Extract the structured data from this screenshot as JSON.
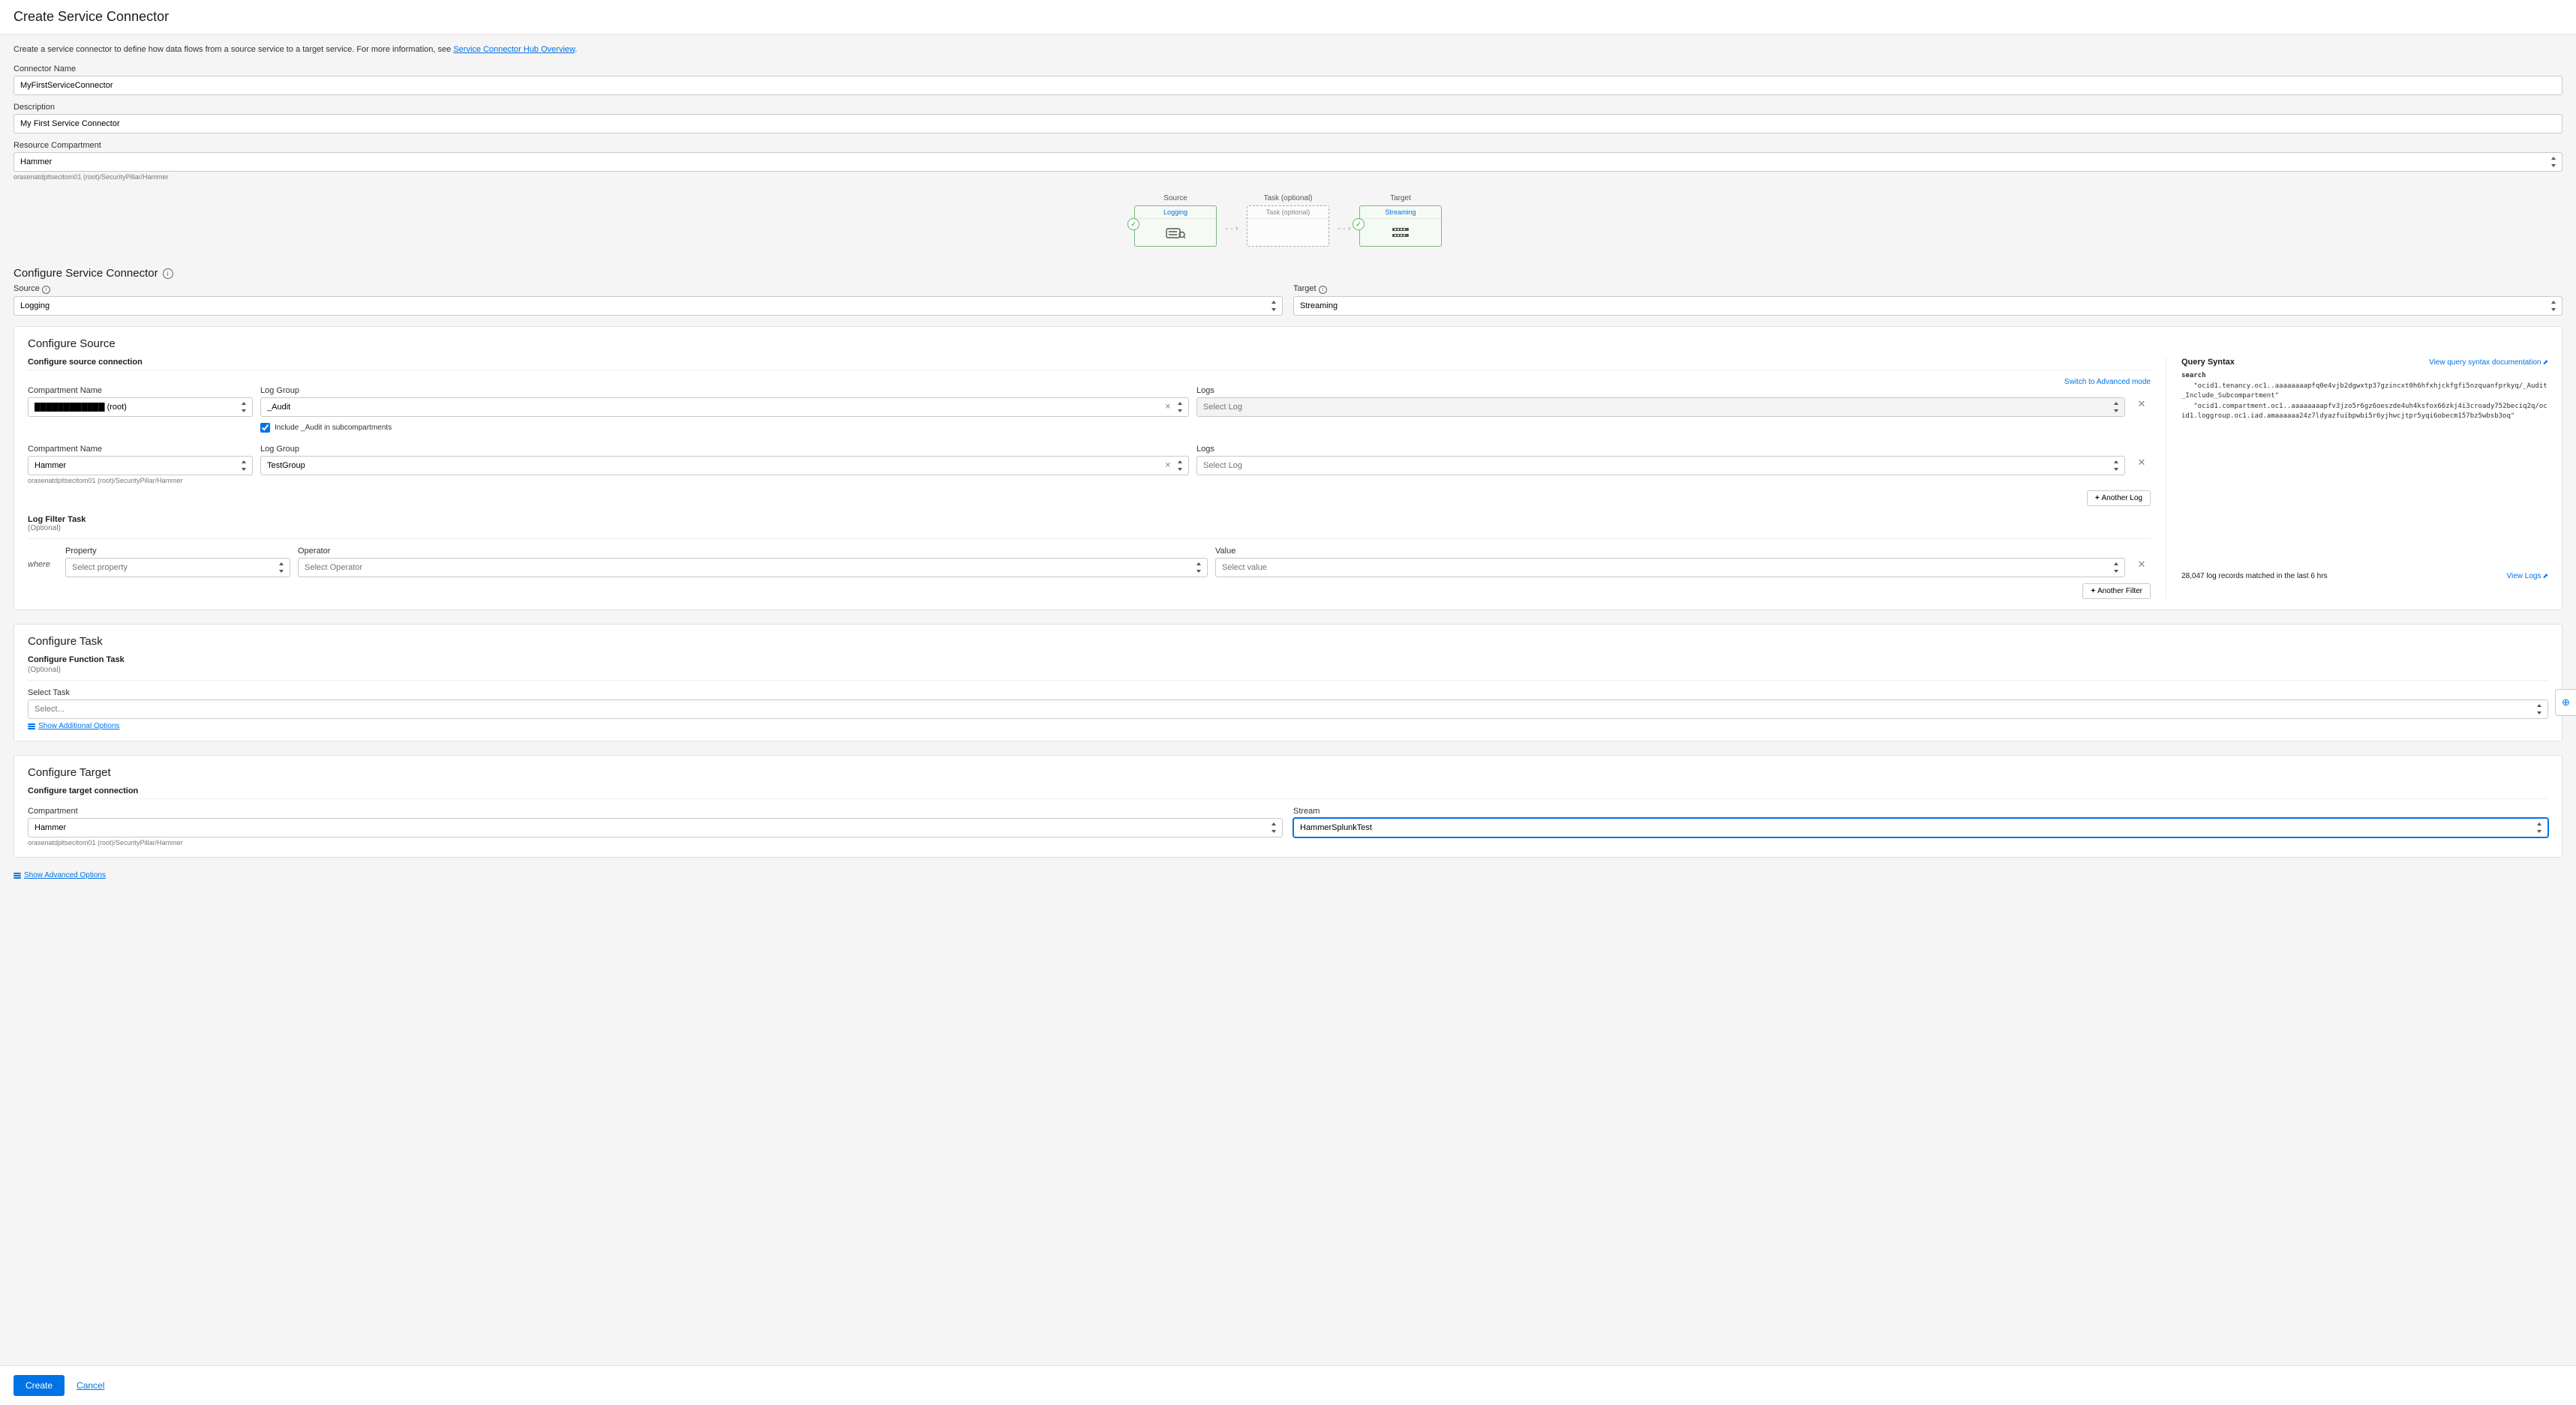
{
  "header": {
    "title": "Create Service Connector"
  },
  "intro": {
    "text_before": "Create a service connector to define how data flows from a source service to a target service. For more information, see ",
    "link_text": "Service Connector Hub Overview",
    "text_after": "."
  },
  "top_fields": {
    "connector_name_label": "Connector Name",
    "connector_name_value": "MyFirstServiceConnector",
    "description_label": "Description",
    "description_value": "My First Service Connector",
    "resource_compartment_label": "Resource Compartment",
    "resource_compartment_value": "Hammer",
    "resource_compartment_path": "orasenatdpltsecitom01 (root)/SecurityPillar/Hammer"
  },
  "flow": {
    "source_label": "Source",
    "source_name": "Logging",
    "task_label": "Task (optional)",
    "task_name": "Task (optional)",
    "target_label": "Target",
    "target_name": "Streaming"
  },
  "configure_section": {
    "title": "Configure Service Connector"
  },
  "source_target_row": {
    "source_label": "Source",
    "source_value": "Logging",
    "target_label": "Target",
    "target_value": "Streaming"
  },
  "configure_source": {
    "title": "Configure Source",
    "sub": "Configure source connection",
    "switch_link": "Switch to Advanced mode",
    "col_compartment": "Compartment Name",
    "col_loggroup": "Log Group",
    "col_logs": "Logs",
    "row1": {
      "compartment": "████████████ (root)",
      "loggroup": "_Audit",
      "logs_placeholder": "Select Log"
    },
    "include_audit": "Include _Audit in subcompartments",
    "row2": {
      "compartment": "Hammer",
      "compartment_path": "orasenatdpltsecitom01 (root)/SecurityPillar/Hammer",
      "loggroup": "TestGroup",
      "logs_placeholder": "Select Log"
    },
    "add_another_log": "Another Log",
    "filter_title": "Log Filter Task",
    "filter_opt": "(Optional)",
    "where": "where",
    "col_property": "Property",
    "property_ph": "Select property",
    "col_operator": "Operator",
    "operator_ph": "Select Operator",
    "col_value": "Value",
    "value_ph": "Select value",
    "add_another_filter": "Another Filter"
  },
  "query": {
    "title": "Query Syntax",
    "doc_link": "View query syntax documentation",
    "search_kw": "search",
    "line1": "\"ocid1.tenancy.oc1..aaaaaaaapfq0e4vjb2dgwxtp37gzincxt0h6hfxhjckfgfi5nzquanfprkyq/_Audit_Include_Subcompartment\"",
    "line2": "\"ocid1.compartment.oc1..aaaaaaaapfv3jzo5r6gz6oeszde4uh4ksfox66zkj4i3croady752beciq2q/ocid1.loggroup.oc1.iad.amaaaaaa24z7ldyazfuibpwbi5r6yjhwcjtpr5yqi6obecm157bz5wbsb3oq\"",
    "match_text": "28,047 log records matched in the last 6 hrs",
    "view_logs": "View Logs"
  },
  "configure_task": {
    "title": "Configure Task",
    "sub": "Configure Function Task",
    "opt": "(Optional)",
    "select_task_label": "Select Task",
    "select_task_ph": "Select...",
    "show_additional": "Show Additional Options"
  },
  "configure_target": {
    "title": "Configure Target",
    "sub": "Configure target connection",
    "compartment_label": "Compartment",
    "compartment_value": "Hammer",
    "compartment_path": "orasenatdpltsecitom01 (root)/SecurityPillar/Hammer",
    "stream_label": "Stream",
    "stream_value": "HammerSplunkTest"
  },
  "advanced": {
    "show_advanced": "Show Advanced Options"
  },
  "footer": {
    "create": "Create",
    "cancel": "Cancel"
  }
}
